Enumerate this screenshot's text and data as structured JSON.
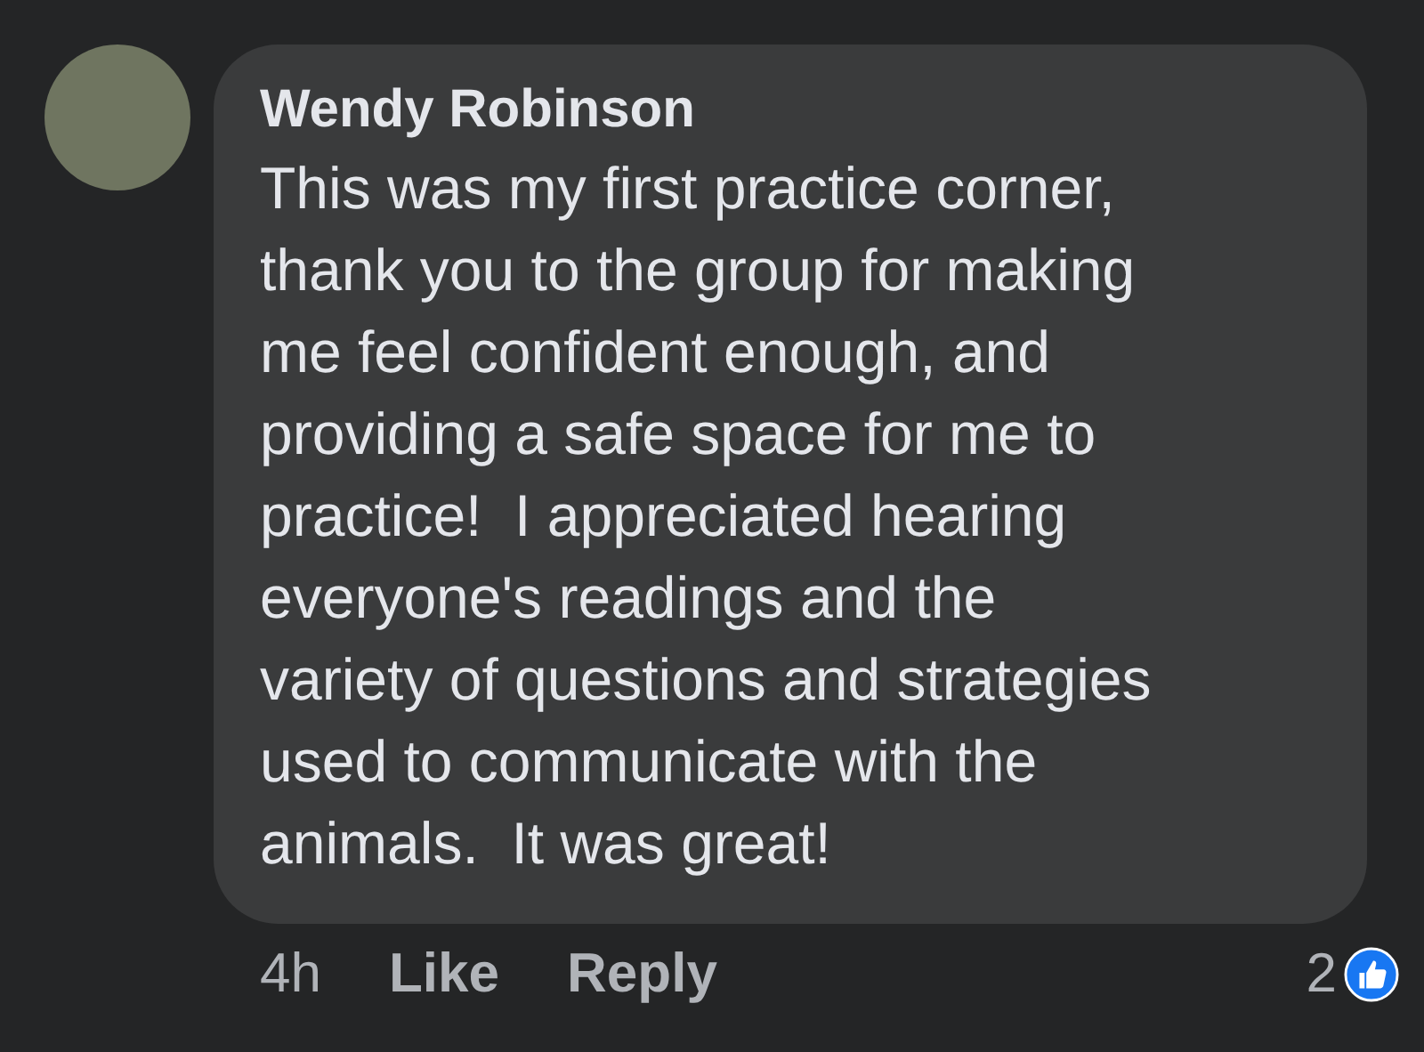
{
  "comment": {
    "author": "Wendy Robinson",
    "text": "This was my first practice corner,\nthank you to the group for making\nme feel confident enough, and\nproviding a safe space for me to\npractice!  I appreciated hearing\neveryone's readings and the\nvariety of questions and strategies\nused to communicate with the\nanimals.  It was great!",
    "time": "4h",
    "actions": [
      "Like",
      "Reply"
    ],
    "reaction_count": "2"
  }
}
